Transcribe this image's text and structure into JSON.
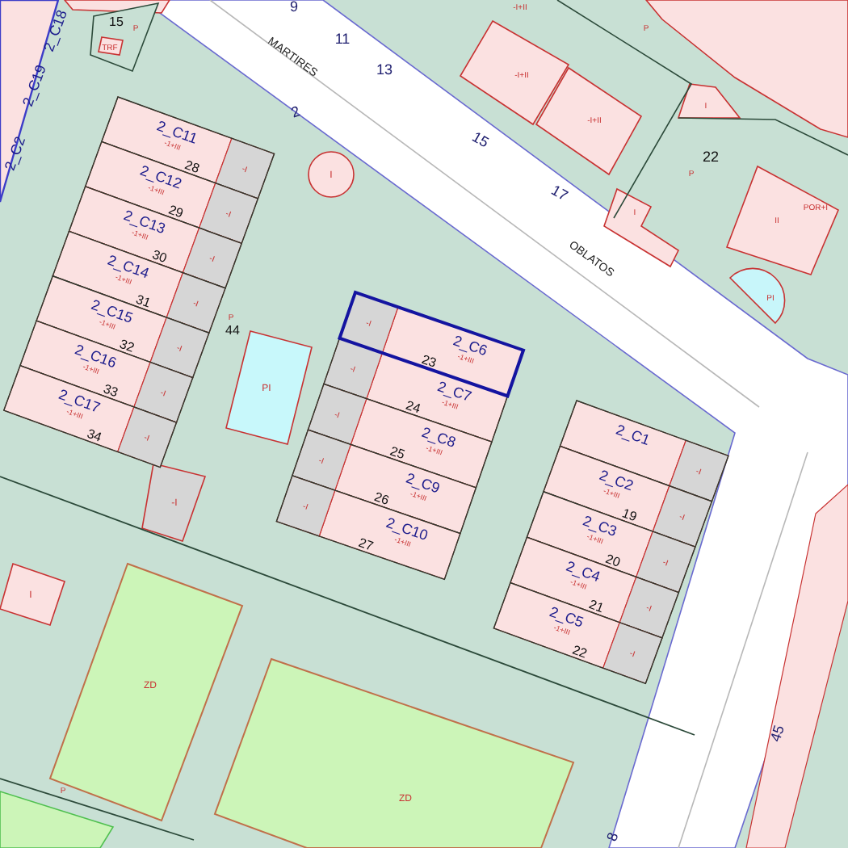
{
  "map": {
    "streets": [
      {
        "name": "MARTIRES"
      },
      {
        "name": "OBLATOS"
      }
    ],
    "street_numbers": [
      "9",
      "11",
      "13",
      "2",
      "15",
      "17",
      "45",
      "8"
    ],
    "edge_labels": [
      "2_C18",
      "2_C19",
      "2_C2"
    ],
    "blocks": [
      {
        "rows": [
          {
            "label": "2_C11",
            "number": "28",
            "floors": "-1+III",
            "yard": "-I",
            "selected": false
          },
          {
            "label": "2_C12",
            "number": "29",
            "floors": "-1+III",
            "yard": "-I",
            "selected": false
          },
          {
            "label": "2_C13",
            "number": "30",
            "floors": "-1+III",
            "yard": "-I",
            "selected": false
          },
          {
            "label": "2_C14",
            "number": "31",
            "floors": "-1+III",
            "yard": "-I",
            "selected": false
          },
          {
            "label": "2_C15",
            "number": "32",
            "floors": "-1+III",
            "yard": "-I",
            "selected": false
          },
          {
            "label": "2_C16",
            "number": "33",
            "floors": "-1+III",
            "yard": "-I",
            "selected": false
          },
          {
            "label": "2_C17",
            "number": "34",
            "floors": "-1+III",
            "yard": "-I",
            "selected": false
          }
        ]
      },
      {
        "rows": [
          {
            "label": "2_C6",
            "number": "23",
            "floors": "-1+III",
            "yard": "-I",
            "selected": true
          },
          {
            "label": "2_C7",
            "number": "24",
            "floors": "-1+III",
            "yard": "-I",
            "selected": false
          },
          {
            "label": "2_C8",
            "number": "25",
            "floors": "-1+III",
            "yard": "-I",
            "selected": false
          },
          {
            "label": "2_C9",
            "number": "26",
            "floors": "-1+III",
            "yard": "-I",
            "selected": false
          },
          {
            "label": "2_C10",
            "number": "27",
            "floors": "-1+III",
            "yard": "-I",
            "selected": false
          }
        ]
      },
      {
        "rows": [
          {
            "label": "2_C1",
            "yard": "-I",
            "selected": false
          },
          {
            "label": "2_C2",
            "number": "19",
            "floors": "-1+III",
            "yard": "-I",
            "selected": false
          },
          {
            "label": "2_C3",
            "number": "20",
            "floors": "-1+III",
            "yard": "-I",
            "selected": false
          },
          {
            "label": "2_C4",
            "number": "21",
            "floors": "-1+III",
            "yard": "-I",
            "selected": false
          },
          {
            "label": "2_C5",
            "number": "22",
            "floors": "-1+III",
            "yard": "-I",
            "selected": false
          }
        ]
      }
    ],
    "plot_codes": [
      "15",
      "P",
      "TRF",
      "I",
      "P",
      "44",
      "PI",
      "-I",
      "I",
      "ZD",
      "ZD",
      "P",
      "-I+II",
      "-I+II",
      "-I+II",
      "P",
      "I",
      "22",
      "P",
      "II",
      "POR+I",
      "I",
      "PI"
    ]
  }
}
